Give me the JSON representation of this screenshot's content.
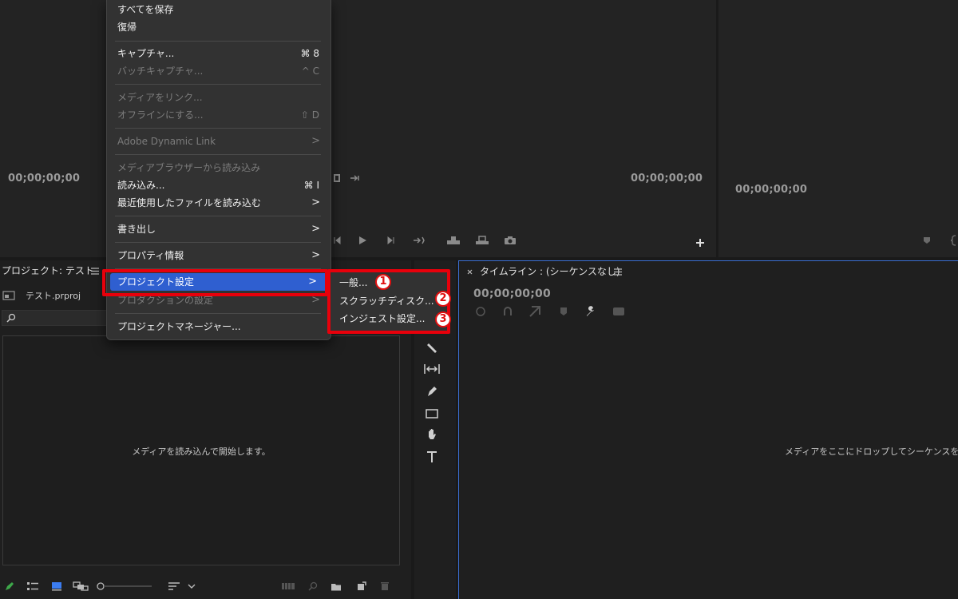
{
  "source_monitor": {
    "timecode": "00;00;00;00"
  },
  "program_monitor": {
    "timecode": "00;00;00;00"
  },
  "reference_monitor": {
    "timecode": "00;00;00;00"
  },
  "project_panel": {
    "tab_label": "プロジェクト: テスト",
    "file_name": "テスト.prproj",
    "empty_message": "メディアを読み込んで開始します。"
  },
  "timeline_panel": {
    "tab_label": "タイムライン : (シーケンスなし)",
    "timecode": "00;00;00;00",
    "empty_message": "メディアをここにドロップしてシーケンスを"
  },
  "file_menu": {
    "items": [
      {
        "label": "すべてを保存",
        "shortcut": "",
        "disabled": false
      },
      {
        "label": "復帰",
        "shortcut": "",
        "disabled": false
      },
      {
        "label": "キャプチャ...",
        "shortcut": "⌘ 8",
        "disabled": false
      },
      {
        "label": "バッチキャプチャ...",
        "shortcut": "^ C",
        "disabled": true
      },
      {
        "label": "メディアをリンク...",
        "shortcut": "",
        "disabled": true
      },
      {
        "label": "オフラインにする...",
        "shortcut": "⇧ D",
        "disabled": true
      },
      {
        "label": "Adobe Dynamic Link",
        "shortcut": ">",
        "disabled": true
      },
      {
        "label": "メディアブラウザーから読み込み",
        "shortcut": "",
        "disabled": true
      },
      {
        "label": "読み込み...",
        "shortcut": "⌘ I",
        "disabled": false
      },
      {
        "label": "最近使用したファイルを読み込む",
        "shortcut": ">",
        "disabled": false
      },
      {
        "label": "書き出し",
        "shortcut": ">",
        "disabled": false
      },
      {
        "label": "プロパティ情報",
        "shortcut": ">",
        "disabled": false
      },
      {
        "label": "プロジェクト設定",
        "shortcut": ">",
        "disabled": false
      },
      {
        "label": "プロダクションの設定",
        "shortcut": ">",
        "disabled": true
      },
      {
        "label": "プロジェクトマネージャー...",
        "shortcut": "",
        "disabled": false
      }
    ]
  },
  "project_settings_submenu": {
    "items": [
      {
        "label": "一般...",
        "badge": "1"
      },
      {
        "label": "スクラッチディスク...",
        "badge": "2"
      },
      {
        "label": "インジェスト設定...",
        "badge": "3"
      }
    ]
  },
  "colors": {
    "highlight": "#2f5fd0",
    "annotation_red": "#e8000b",
    "timeline_focus": "#3b6fd4"
  }
}
